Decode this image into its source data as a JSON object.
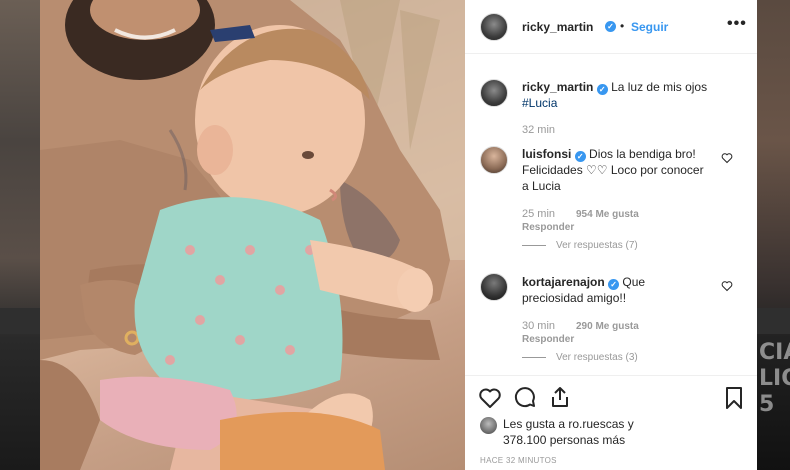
{
  "post": {
    "username": "ricky_martin",
    "follow_label": "Seguir",
    "more_label": "•••",
    "caption_text": "La luz de mis ojos",
    "caption_hashtag": "#Lucia",
    "caption_time": "32 min",
    "likes_line1": "Les gusta a ro.ruescas y",
    "likes_line2": "378.100 personas más",
    "time_ago": "HACE 32 MINUTOS"
  },
  "comments": [
    {
      "username": "luisfonsi",
      "text_line1": "Dios la bendiga bro!",
      "text_line2": "Felicidades ♡♡ Loco por conocer",
      "text_line3": "a Lucia",
      "time": "25 min",
      "likes": "954 Me gusta",
      "reply_label": "Responder",
      "view_replies": "Ver respuestas (7)"
    },
    {
      "username": "kortajarenajon",
      "text_line1": "Que",
      "text_line2": "preciosidad amigo!!",
      "time": "30 min",
      "likes": "290 Me gusta",
      "reply_label": "Responder",
      "view_replies": "Ver respuestas (3)"
    }
  ],
  "background": {
    "right_text": "CIA\nLIO\n5"
  },
  "icons": {
    "like": "heart-icon",
    "comment": "comment-icon",
    "share": "share-icon",
    "save": "bookmark-icon",
    "more": "more-icon",
    "verified": "verified-badge-icon"
  },
  "colors": {
    "accent": "#3897f0",
    "hashtag": "#003569",
    "muted": "#999999",
    "text": "#262626"
  }
}
